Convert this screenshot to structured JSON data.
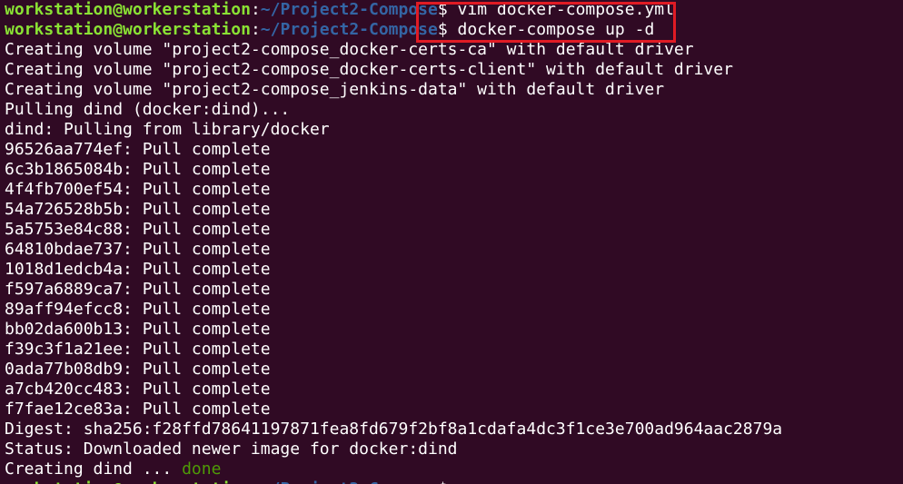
{
  "prompt": {
    "user_host": "workstation@workerstation",
    "separator": ":",
    "path": "~/Project2-Compose",
    "symbol": "$"
  },
  "commands": {
    "first": " vim docker-compose.yml",
    "second": " docker-compose up -d"
  },
  "output_lines": [
    "Creating volume \"project2-compose_docker-certs-ca\" with default driver",
    "Creating volume \"project2-compose_docker-certs-client\" with default driver",
    "Creating volume \"project2-compose_jenkins-data\" with default driver",
    "Pulling dind (docker:dind)...",
    "dind: Pulling from library/docker",
    "96526aa774ef: Pull complete",
    "6c3b1865084b: Pull complete",
    "4f4fb700ef54: Pull complete",
    "54a726528b5b: Pull complete",
    "5a5753e84c88: Pull complete",
    "64810bdae737: Pull complete",
    "1018d1edcb4a: Pull complete",
    "f597a6889ca7: Pull complete",
    "89aff94efcc8: Pull complete",
    "bb02da600b13: Pull complete",
    "f39c3f1a21ee: Pull complete",
    "0ada77b08db9: Pull complete",
    "a7cb420cc483: Pull complete",
    "f7fae12ce83a: Pull complete",
    "Digest: sha256:f28ffd78641197871fea8fd679f2bf8a1cdafa4dc3f1ce3e700ad964aac2879a",
    "Status: Downloaded newer image for docker:dind"
  ],
  "creating_line": {
    "text": "Creating dind ... ",
    "status": "done"
  },
  "colors": {
    "background": "#300a24",
    "prompt_user": "#8ae234",
    "prompt_path": "#3465a4",
    "done": "#4e9a06",
    "highlight_border": "#e01b24"
  }
}
